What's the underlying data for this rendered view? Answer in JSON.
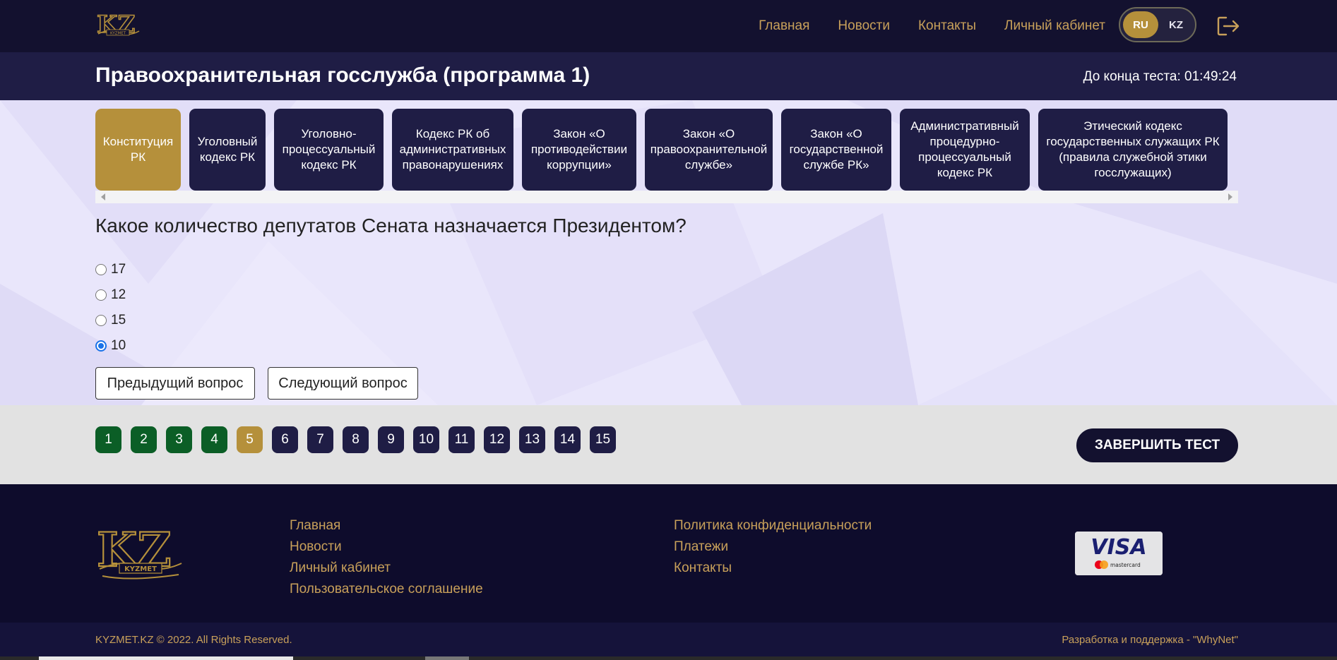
{
  "brand": {
    "logo_text": "KZ",
    "logo_subtext": "KYZMET"
  },
  "nav": {
    "items": [
      {
        "label": "Главная"
      },
      {
        "label": "Новости"
      },
      {
        "label": "Контакты"
      },
      {
        "label": "Личный кабинет"
      }
    ],
    "lang_ru": "RU",
    "lang_kz": "KZ",
    "active_lang": "RU",
    "logout_icon": "logout-icon"
  },
  "test": {
    "title": "Правоохранительная госслужба (программа 1)",
    "timer": "До конца теста: 01:49:24"
  },
  "categories": [
    {
      "label": "Конституция РК",
      "active": true
    },
    {
      "label": "Уголовный кодекс РК",
      "active": false
    },
    {
      "label": "Уголовно-процессуальный кодекс РК",
      "active": false
    },
    {
      "label": "Кодекс РК об административных правонарушениях",
      "active": false
    },
    {
      "label": "Закон «О противодействии коррупции»",
      "active": false
    },
    {
      "label": "Закон «О правоохранительной службе»",
      "active": false
    },
    {
      "label": "Закон «О государственной службе РК»",
      "active": false
    },
    {
      "label": "Административный процедурно-процессуальный кодекс РК",
      "active": false
    },
    {
      "label": "Этический кодекс государственных служащих РК (правила служебной этики госслужащих)",
      "active": false
    }
  ],
  "question": {
    "text": "Какое количество депутатов Сената назначается Президентом?",
    "answers": [
      {
        "label": "17",
        "selected": false
      },
      {
        "label": "12",
        "selected": false
      },
      {
        "label": "15",
        "selected": false
      },
      {
        "label": "10",
        "selected": true
      }
    ],
    "prev_label": "Предыдущий вопрос",
    "next_label": "Следующий вопрос"
  },
  "pager": {
    "numbers": [
      {
        "n": "1",
        "state": "done"
      },
      {
        "n": "2",
        "state": "done"
      },
      {
        "n": "3",
        "state": "done"
      },
      {
        "n": "4",
        "state": "done"
      },
      {
        "n": "5",
        "state": "current"
      },
      {
        "n": "6",
        "state": "todo"
      },
      {
        "n": "7",
        "state": "todo"
      },
      {
        "n": "8",
        "state": "todo"
      },
      {
        "n": "9",
        "state": "todo"
      },
      {
        "n": "10",
        "state": "todo"
      },
      {
        "n": "11",
        "state": "todo"
      },
      {
        "n": "12",
        "state": "todo"
      },
      {
        "n": "13",
        "state": "todo"
      },
      {
        "n": "14",
        "state": "todo"
      },
      {
        "n": "15",
        "state": "todo"
      }
    ],
    "finish_label": "ЗАВЕРШИТЬ ТЕСТ"
  },
  "footer": {
    "col1": [
      "Главная",
      "Новости",
      "Личный кабинет",
      "Пользовательское соглашение"
    ],
    "col2": [
      "Политика конфиденциальности",
      "Платежи",
      "Контакты"
    ],
    "payment": {
      "visa": "VISA",
      "mastercard": "mastercard"
    },
    "copyright": "KYZMET.KZ © 2022. All Rights Reserved.",
    "developer": "Разработка и поддержка - \"WhyNet\""
  },
  "colors": {
    "gold": "#b5903b",
    "navy": "#1f1d45",
    "done_green": "#0b5e26",
    "link_gold": "#c8a05a"
  }
}
